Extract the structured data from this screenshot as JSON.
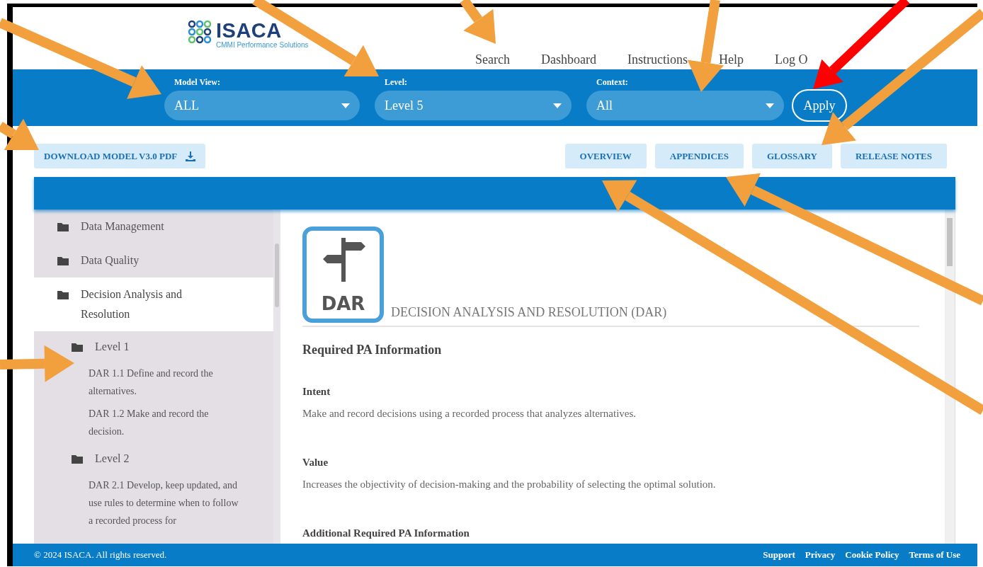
{
  "logo": {
    "name": "ISACA",
    "tagline": "CMMI Performance Solutions"
  },
  "nav": [
    "Search",
    "Dashboard",
    "Instructions",
    "Help",
    "Log O"
  ],
  "filters": [
    {
      "label": "Model View:",
      "value": "ALL"
    },
    {
      "label": "Level:",
      "value": "Level 5"
    },
    {
      "label": "Context:",
      "value": "All"
    }
  ],
  "apply_button": "Apply",
  "download_button": "DOWNLOAD MODEL V3.0 PDF",
  "section_tabs": [
    "OVERVIEW",
    "APPENDICES",
    "GLOSSARY",
    "RELEASE NOTES"
  ],
  "sidebar": {
    "items": [
      {
        "label": "Data Management",
        "selected": false
      },
      {
        "label": "Data Quality",
        "selected": false
      },
      {
        "label": "Decision Analysis and Resolution",
        "selected": true,
        "children": [
          {
            "label": "Level 1",
            "selected": false,
            "children": [
              {
                "label": "DAR 1.1 Define and record the alternatives.",
                "selected": false
              },
              {
                "label": "DAR 1.2 Make and record the decision.",
                "selected": false
              }
            ]
          },
          {
            "label": "Level 2",
            "selected": false,
            "children": [
              {
                "label": "DAR 2.1 Develop, keep updated, and use rules to determine when to follow a recorded process for",
                "selected": false
              }
            ]
          }
        ]
      }
    ]
  },
  "content": {
    "badge": "DAR",
    "title": "DECISION ANALYSIS AND RESOLUTION (DAR)",
    "heading": "Required PA Information",
    "sections": [
      {
        "heading": "Intent",
        "text": "Make and record decisions using a recorded process that analyzes alternatives."
      },
      {
        "heading": "Value",
        "text": "Increases the objectivity of decision-making and the probability of selecting the optimal solution."
      },
      {
        "heading": "Additional Required PA Information"
      }
    ]
  },
  "footer": {
    "copyright": "© 2024 ISACA. All rights reserved.",
    "links": [
      "Support",
      "Privacy",
      "Cookie Policy",
      "Terms of Use"
    ]
  },
  "annotations": [
    {
      "color": "#f2a03d"
    },
    {
      "color": "#f2a03d"
    },
    {
      "color": "#f2a03d"
    },
    {
      "color": "#f2a03d"
    },
    {
      "color": "#ff0000"
    },
    {
      "color": "#f2a03d"
    },
    {
      "color": "#f2a03d"
    },
    {
      "color": "#f2a03d"
    },
    {
      "color": "#f2a03d"
    },
    {
      "color": "#f2a03d"
    }
  ]
}
